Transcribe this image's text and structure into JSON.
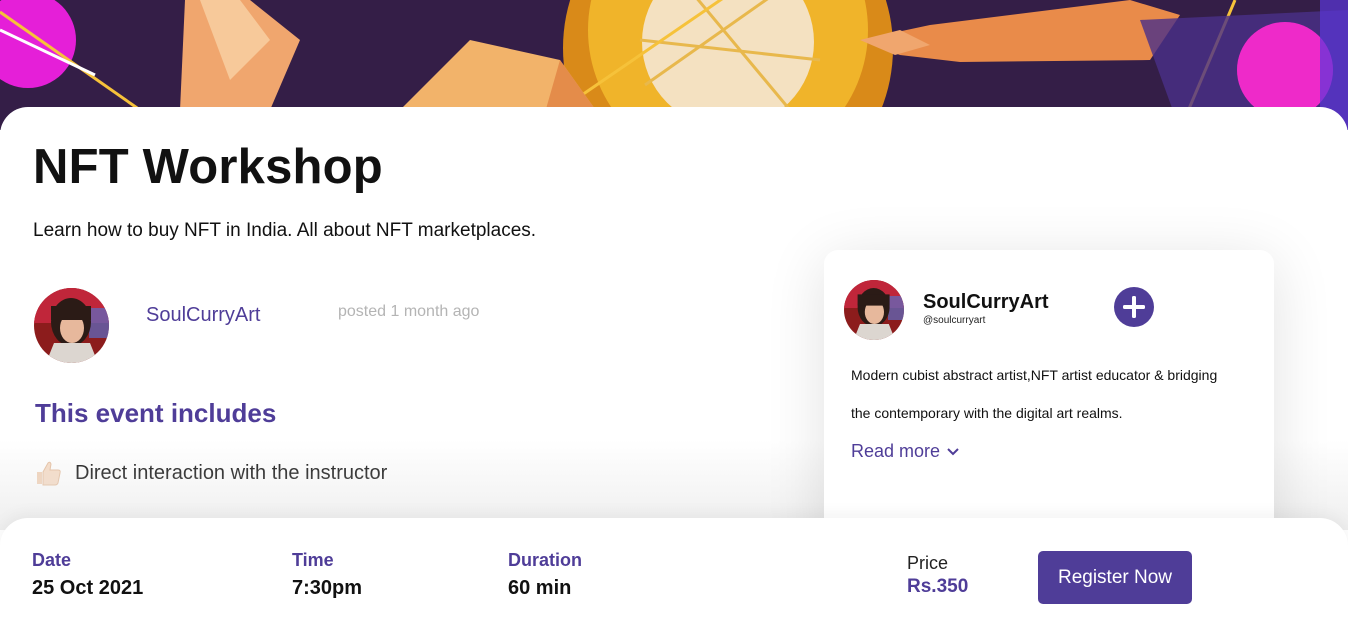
{
  "event": {
    "title": "NFT Workshop",
    "description": "Learn how to buy NFT in India. All about NFT marketplaces."
  },
  "author": {
    "name": "SoulCurryArt",
    "posted": "posted 1 month ago"
  },
  "includes": {
    "heading": "This event includes",
    "items": [
      {
        "icon": "thumbs-up-icon",
        "text": "Direct interaction with the instructor"
      }
    ]
  },
  "artist_card": {
    "name": "SoulCurryArt",
    "handle": "@soulcurryart",
    "bio_line1": "Modern cubist abstract artist,NFT artist educator & bridging",
    "bio_line2": "the contemporary with the digital art realms.",
    "read_more": "Read more",
    "follow_icon": "plus-icon"
  },
  "details": {
    "date_label": "Date",
    "date_value": "25 Oct 2021",
    "time_label": "Time",
    "time_value": "7:30pm",
    "duration_label": "Duration",
    "duration_value": "60 min",
    "price_label": "Price",
    "price_value": "Rs.350",
    "register_label": "Register Now"
  },
  "colors": {
    "accent": "#4f3d98",
    "banner_bg": "#2e1b3f",
    "muted_text": "#b4b4b4"
  }
}
